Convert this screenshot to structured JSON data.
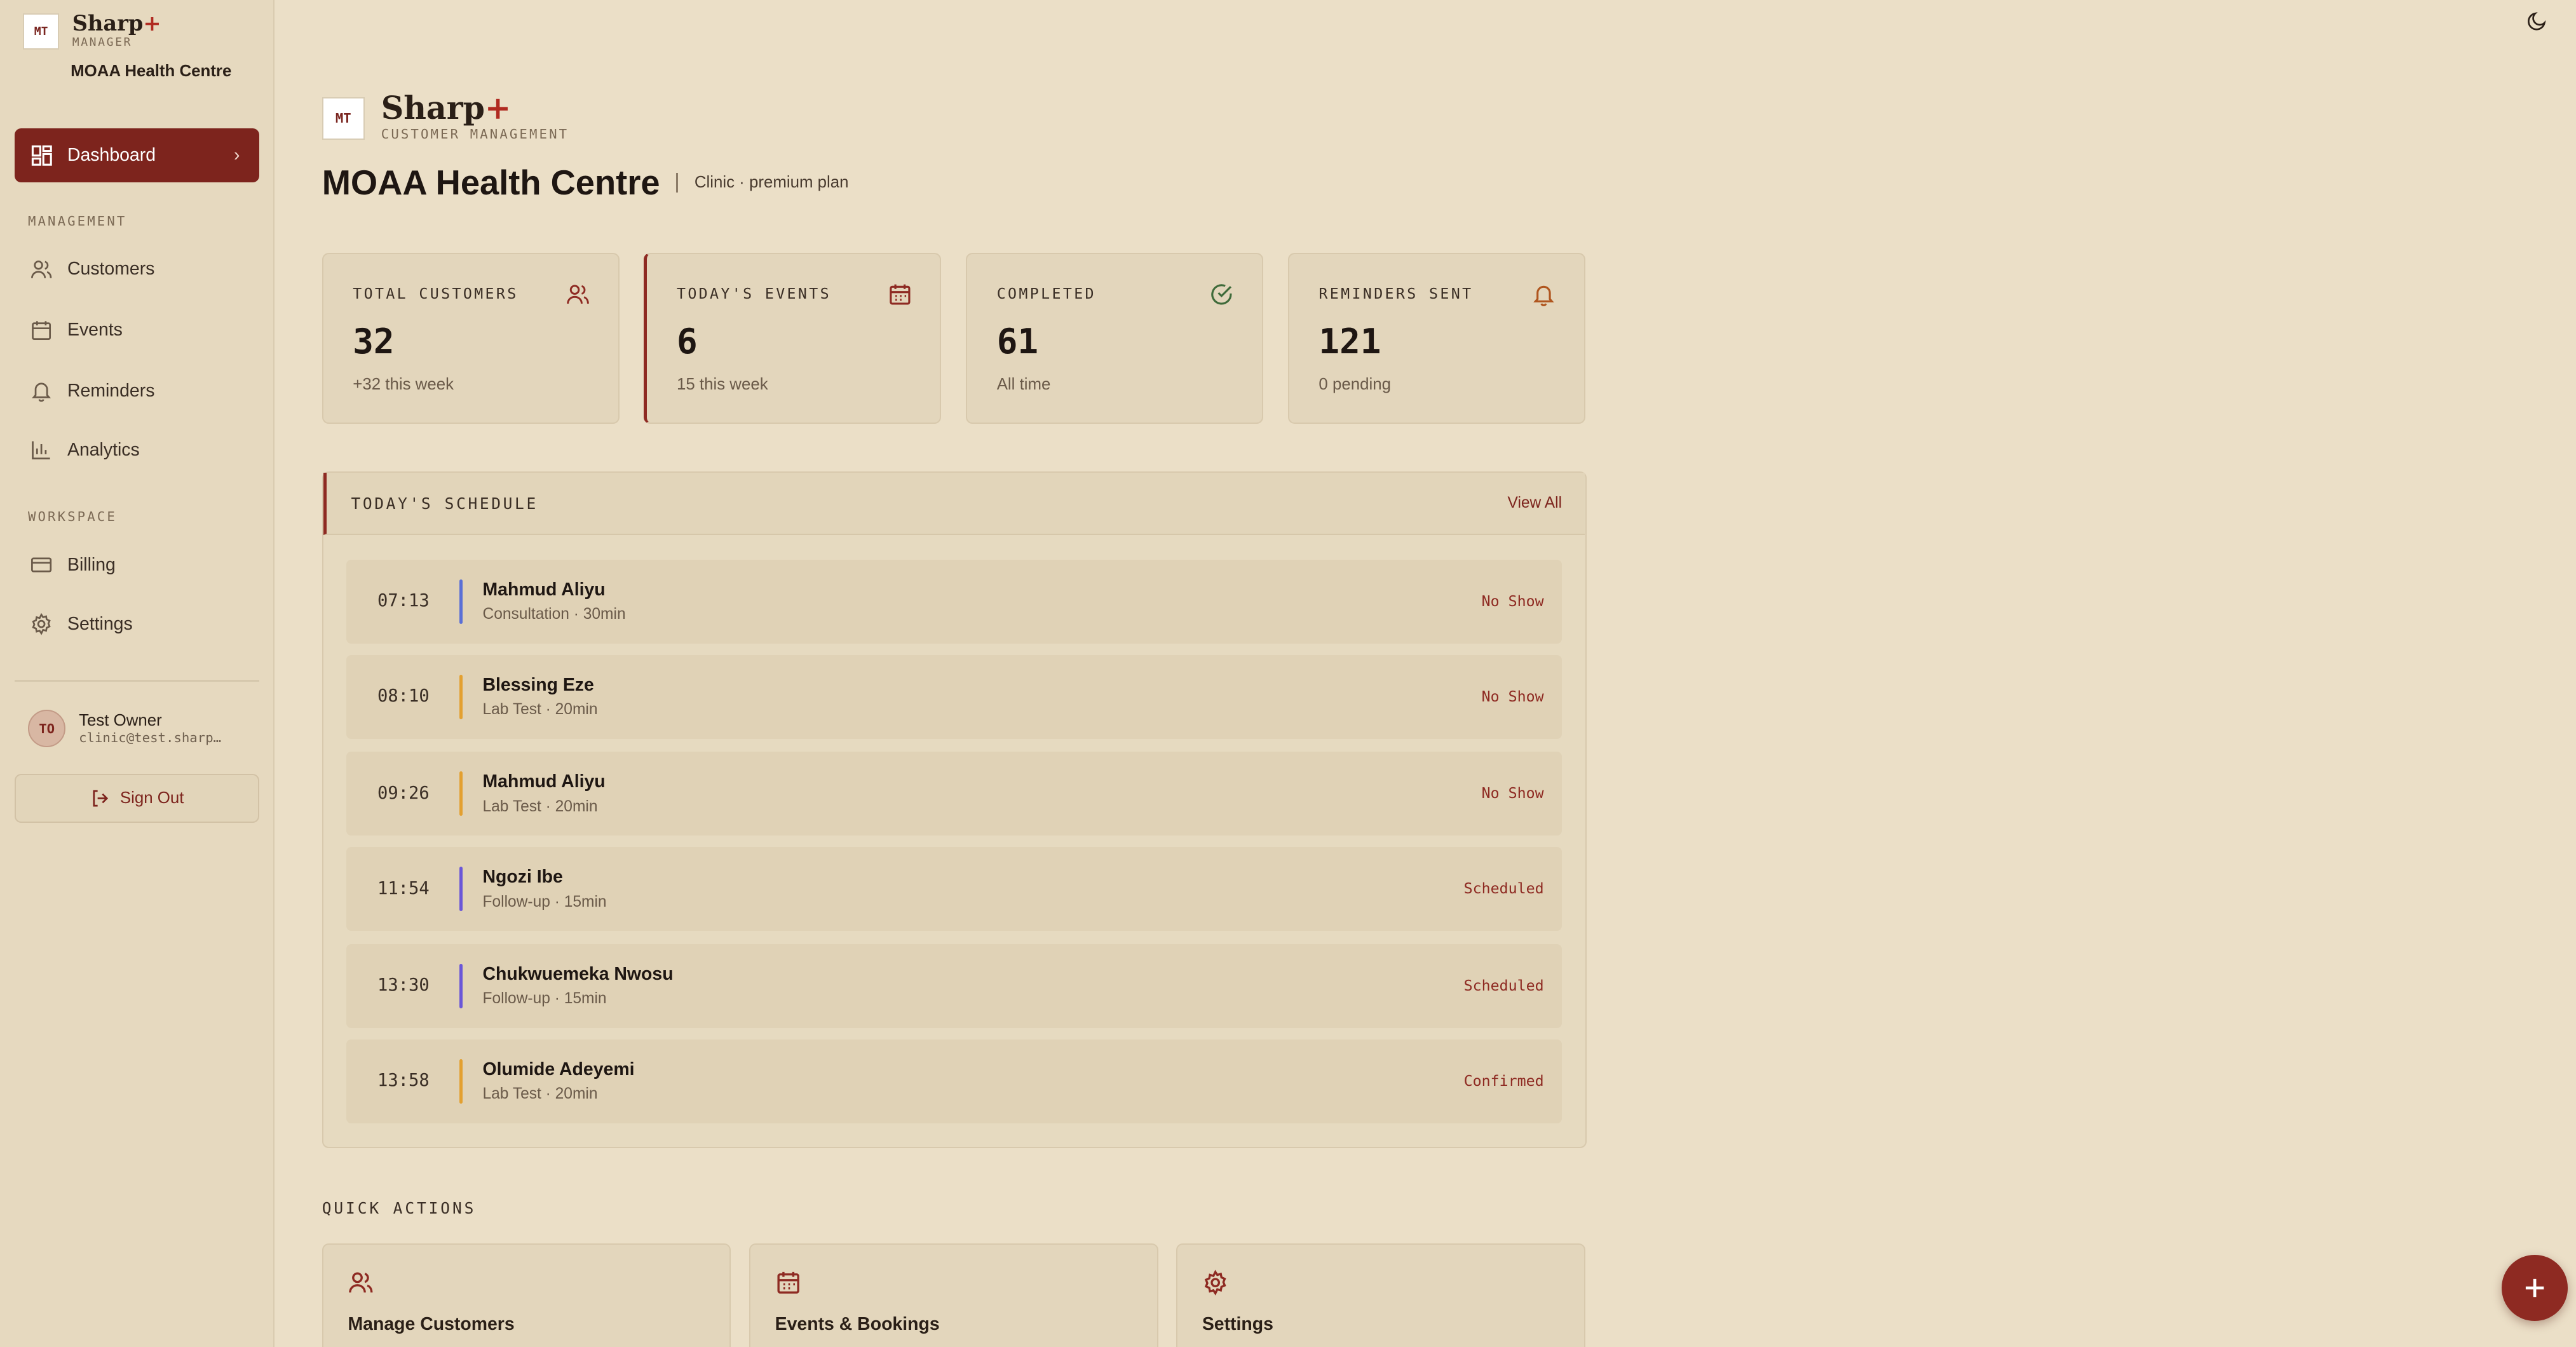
{
  "brand": {
    "badge": "MT",
    "name": "Sharp",
    "plus": "+",
    "role": "MANAGER",
    "org": "MOAA Health Centre"
  },
  "nav": {
    "dashboard": "Dashboard",
    "management_label": "MANAGEMENT",
    "customers": "Customers",
    "events": "Events",
    "reminders": "Reminders",
    "analytics": "Analytics",
    "workspace_label": "WORKSPACE",
    "billing": "Billing",
    "settings": "Settings"
  },
  "user": {
    "initials": "TO",
    "name": "Test Owner",
    "email": "clinic@test.sharp…",
    "signout": "Sign Out"
  },
  "header": {
    "badge": "MT",
    "name": "Sharp",
    "plus": "+",
    "sub": "CUSTOMER MANAGEMENT",
    "title": "MOAA Health Centre",
    "plan": "Clinic · premium plan"
  },
  "stats": [
    {
      "label": "TOTAL CUSTOMERS",
      "value": "32",
      "sub": "+32 this week",
      "icon": "users-icon"
    },
    {
      "label": "TODAY'S EVENTS",
      "value": "6",
      "sub": "15 this week",
      "icon": "calendar-icon"
    },
    {
      "label": "COMPLETED",
      "value": "61",
      "sub": "All time",
      "icon": "check-circle-icon"
    },
    {
      "label": "REMINDERS SENT",
      "value": "121",
      "sub": "0 pending",
      "icon": "bell-icon"
    }
  ],
  "schedule": {
    "title": "TODAY'S SCHEDULE",
    "view_all": "View All",
    "rows": [
      {
        "time": "07:13",
        "name": "Mahmud Aliyu",
        "type": "Consultation · 30min",
        "status": "No Show",
        "color": "#5a6fd6"
      },
      {
        "time": "08:10",
        "name": "Blessing Eze",
        "type": "Lab Test · 20min",
        "status": "No Show",
        "color": "#e3a030"
      },
      {
        "time": "09:26",
        "name": "Mahmud Aliyu",
        "type": "Lab Test · 20min",
        "status": "No Show",
        "color": "#e3a030"
      },
      {
        "time": "11:54",
        "name": "Ngozi Ibe",
        "type": "Follow-up · 15min",
        "status": "Scheduled",
        "color": "#6a56d8"
      },
      {
        "time": "13:30",
        "name": "Chukwuemeka Nwosu",
        "type": "Follow-up · 15min",
        "status": "Scheduled",
        "color": "#6a56d8"
      },
      {
        "time": "13:58",
        "name": "Olumide Adeyemi",
        "type": "Lab Test · 20min",
        "status": "Confirmed",
        "color": "#e3a030"
      }
    ]
  },
  "quick_actions": {
    "label": "QUICK ACTIONS",
    "items": [
      {
        "label": "Manage Customers",
        "icon": "users-icon"
      },
      {
        "label": "Events & Bookings",
        "icon": "calendar-icon"
      },
      {
        "label": "Settings",
        "icon": "gear-icon"
      }
    ]
  },
  "colors": {
    "accent": "#7d241d",
    "background": "#ebdfc7",
    "sidebar": "#e6d9bf"
  }
}
